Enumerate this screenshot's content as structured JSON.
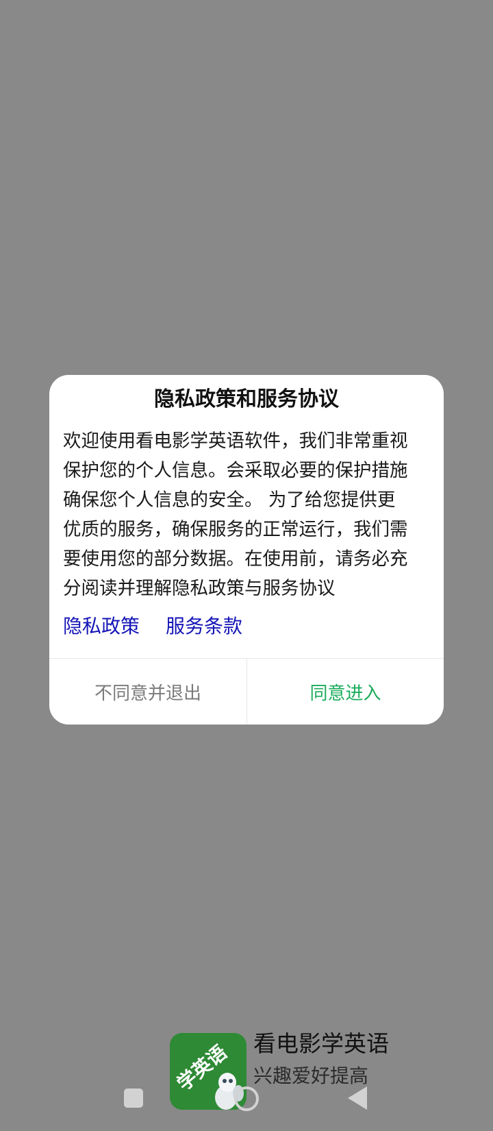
{
  "dialog": {
    "title": "隐私政策和服务协议",
    "body_lines": [
      "欢迎使用看电影学英语软件，我们非常重视",
      "保护您的个人信息。会采取必要的保护措施",
      "确保您个人信息的安全。 为了给您提供更",
      "优质的服务，确保服务的正常运行，我们需",
      "要使用您的部分数据。在使用前，请务必充",
      "分阅读并理解隐私政策与服务协议"
    ],
    "links": {
      "privacy_policy": "隐私政策",
      "terms_of_service": "服务条款"
    },
    "buttons": {
      "decline": "不同意并退出",
      "agree": "同意进入"
    },
    "colors": {
      "link": "#1414b8",
      "agree": "#1bab5b",
      "decline": "#7a7a7a"
    }
  },
  "splash": {
    "logo_text": "学英语",
    "app_name": "看电影学英语",
    "tagline": "兴趣爱好提高",
    "logo_color": "#2e8a35"
  },
  "nav_bar": {
    "icons": [
      "recents-square-icon",
      "home-circle-icon",
      "back-triangle-icon"
    ]
  },
  "background_color": "#898989"
}
